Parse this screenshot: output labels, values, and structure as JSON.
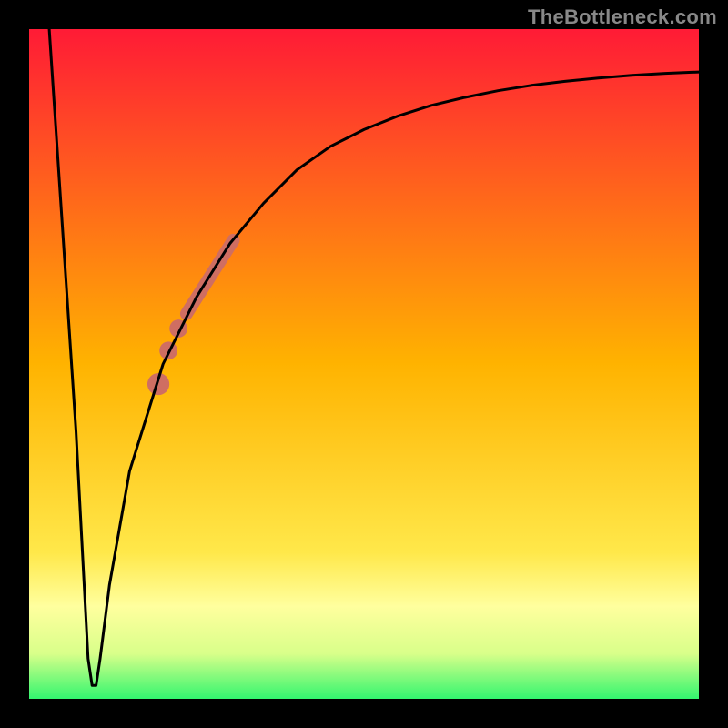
{
  "watermark": "TheBottleneck.com",
  "chart_data": {
    "type": "line",
    "title": "",
    "xlabel": "",
    "ylabel": "",
    "xlim": [
      0,
      100
    ],
    "ylim": [
      0,
      100
    ],
    "grid": false,
    "legend": false,
    "background_gradient": {
      "top_color": "#ff1a36",
      "mid_color": "#ffd400",
      "band_color": "#ffff9e",
      "bottom_color": "#2cf56e"
    },
    "series": [
      {
        "name": "bottleneck_curve",
        "x": [
          3.0,
          5.0,
          7.0,
          8.8,
          9.4,
          10.0,
          10.6,
          12.0,
          15.0,
          20.0,
          25.0,
          30.0,
          35.0,
          40.0,
          45.0,
          50.0,
          55.0,
          60.0,
          65.0,
          70.0,
          75.0,
          80.0,
          85.0,
          90.0,
          95.0,
          100.0
        ],
        "y": [
          100.0,
          70.0,
          40.0,
          6.0,
          2.0,
          2.0,
          6.0,
          17.0,
          34.0,
          50.0,
          60.0,
          68.0,
          74.0,
          79.0,
          82.5,
          85.0,
          87.0,
          88.6,
          89.8,
          90.8,
          91.6,
          92.2,
          92.7,
          93.1,
          93.4,
          93.6
        ]
      }
    ],
    "highlight_segments": [
      {
        "name": "thick_band",
        "x0": 23.5,
        "y0": 57.5,
        "x1": 30.5,
        "y1": 68.5
      },
      {
        "name": "dot_high",
        "cx": 22.3,
        "cy": 55.3,
        "r": 0.8
      },
      {
        "name": "dot_mid",
        "cx": 20.8,
        "cy": 52.0,
        "r": 0.8
      },
      {
        "name": "dot_low",
        "cx": 19.3,
        "cy": 47.0,
        "r": 1.1
      }
    ],
    "highlight_color": "#cf6e62",
    "curve_stroke": "#000000",
    "frame_stroke": "#000000",
    "frame_stroke_width": 32
  }
}
